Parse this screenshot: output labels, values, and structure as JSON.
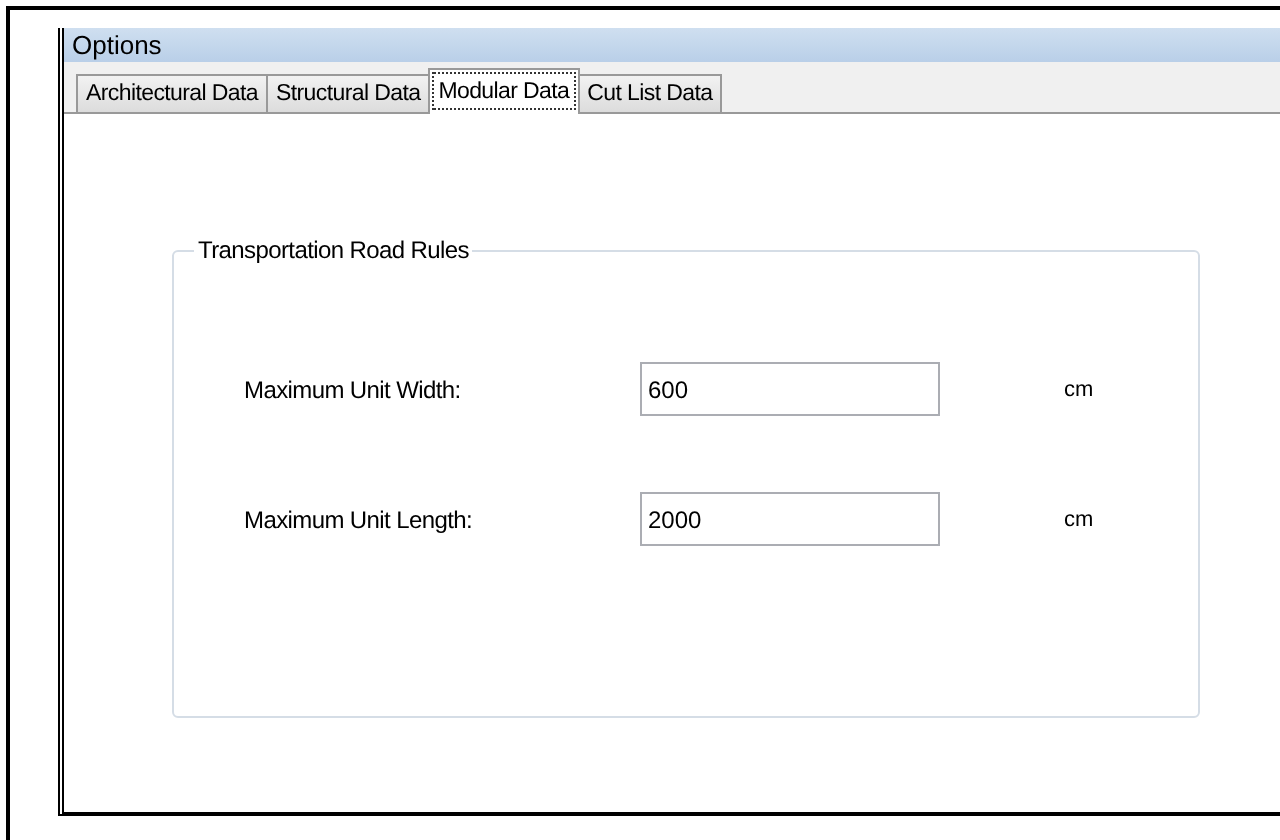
{
  "window": {
    "title": "Options"
  },
  "tabs": [
    {
      "label": "Architectural Data",
      "selected": false
    },
    {
      "label": "Structural Data",
      "selected": false
    },
    {
      "label": "Modular Data",
      "selected": true
    },
    {
      "label": "Cut List Data",
      "selected": false
    }
  ],
  "group": {
    "title": "Transportation Road Rules",
    "fields": [
      {
        "label": "Maximum Unit Width:",
        "value": "600",
        "unit": "cm"
      },
      {
        "label": "Maximum Unit Length:",
        "value": "2000",
        "unit": "cm"
      }
    ]
  }
}
